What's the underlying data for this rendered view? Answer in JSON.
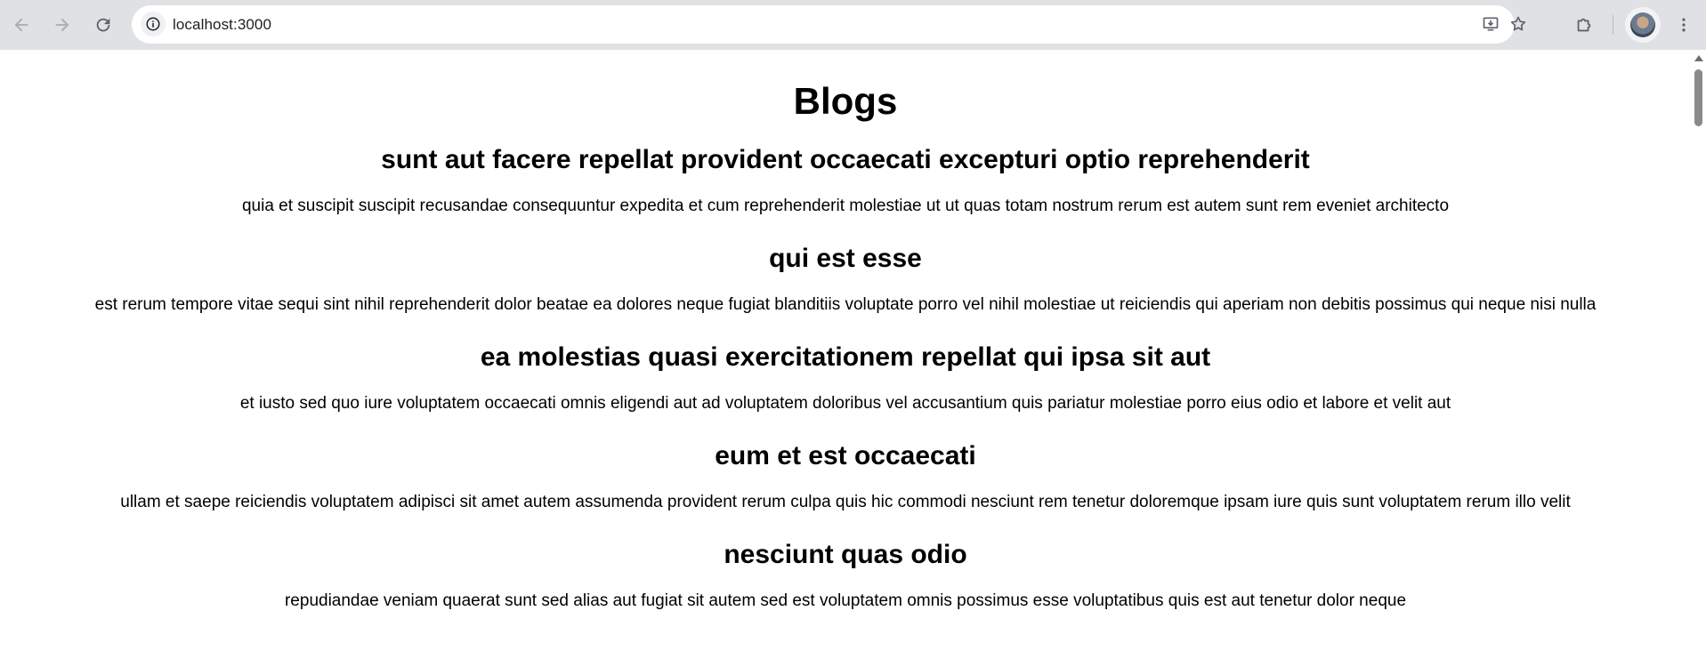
{
  "browser": {
    "url": "localhost:3000",
    "icons": {
      "back": "arrow-left-icon",
      "forward": "arrow-right-icon",
      "reload": "reload-icon",
      "site_info": "info-icon",
      "install": "install-app-icon",
      "bookmark": "star-icon",
      "extensions": "puzzle-icon",
      "profile": "avatar",
      "menu": "kebab-menu-icon"
    }
  },
  "page": {
    "title": "Blogs",
    "posts": [
      {
        "title": "sunt aut facere repellat provident occaecati excepturi optio reprehenderit",
        "body": "quia et suscipit suscipit recusandae consequuntur expedita et cum reprehenderit molestiae ut ut quas totam nostrum rerum est autem sunt rem eveniet architecto"
      },
      {
        "title": "qui est esse",
        "body": "est rerum tempore vitae sequi sint nihil reprehenderit dolor beatae ea dolores neque fugiat blanditiis voluptate porro vel nihil molestiae ut reiciendis qui aperiam non debitis possimus qui neque nisi nulla"
      },
      {
        "title": "ea molestias quasi exercitationem repellat qui ipsa sit aut",
        "body": "et iusto sed quo iure voluptatem occaecati omnis eligendi aut ad voluptatem doloribus vel accusantium quis pariatur molestiae porro eius odio et labore et velit aut"
      },
      {
        "title": "eum et est occaecati",
        "body": "ullam et saepe reiciendis voluptatem adipisci sit amet autem assumenda provident rerum culpa quis hic commodi nesciunt rem tenetur doloremque ipsam iure quis sunt voluptatem rerum illo velit"
      },
      {
        "title": "nesciunt quas odio",
        "body": "repudiandae veniam quaerat sunt sed alias aut fugiat sit autem sed est voluptatem omnis possimus esse voluptatibus quis est aut tenetur dolor neque"
      }
    ]
  },
  "colors": {
    "chrome_bg": "#dfe1e5",
    "omnibox_bg": "#ffffff",
    "icon": "#5f6368",
    "icon_disabled": "#a8abaf",
    "text": "#000000"
  }
}
